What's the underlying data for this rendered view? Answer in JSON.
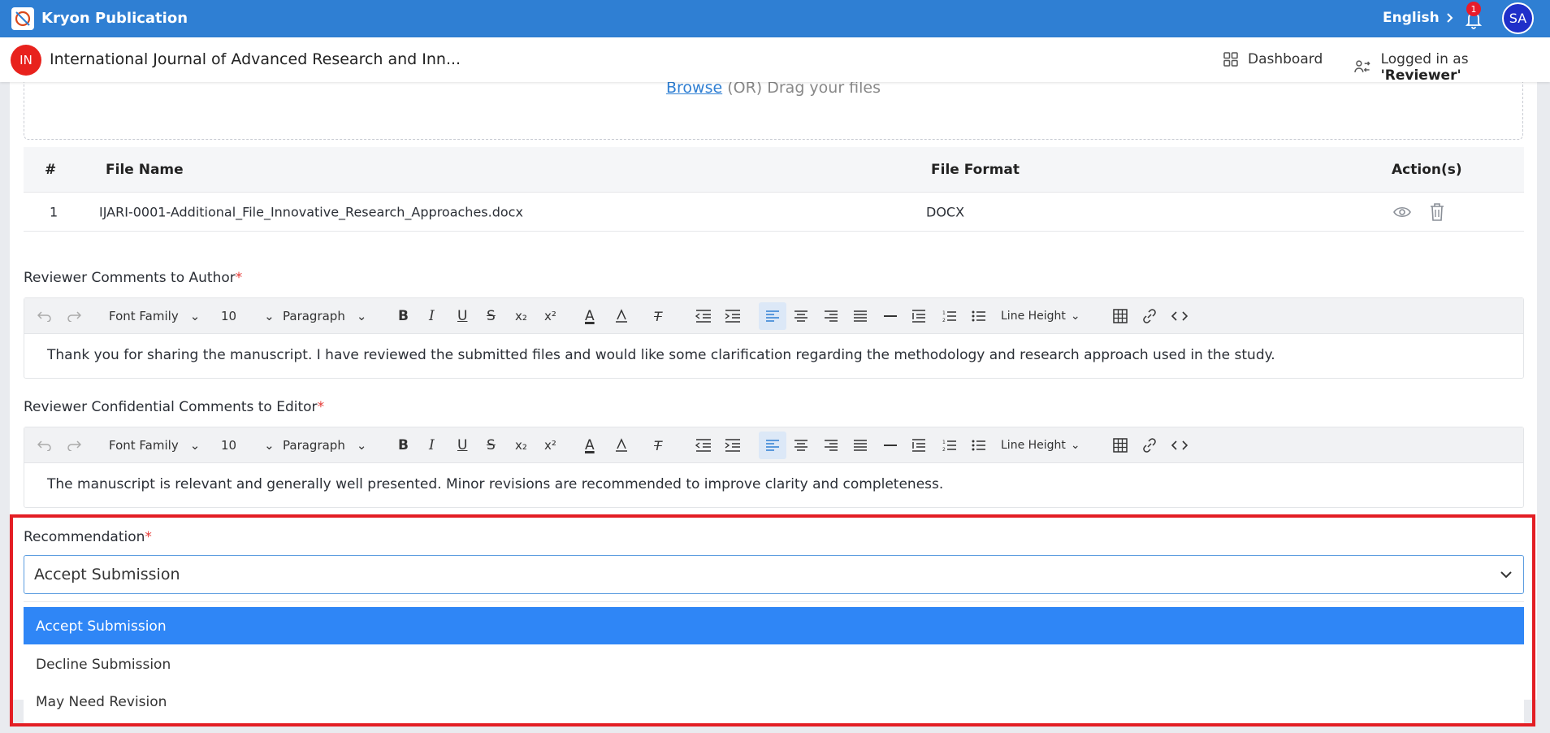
{
  "app": {
    "name": "Kryon Publication",
    "language": "English",
    "notifications": "1",
    "user_initials": "SA"
  },
  "header": {
    "journal_initials": "IN",
    "journal_title": "International Journal of Advanced Research and Inn...",
    "dashboard_label": "Dashboard",
    "logged_prefix": "Logged in as",
    "logged_role": "'Reviewer'"
  },
  "upload": {
    "browse_label": "Browse",
    "rest": " (OR) Drag your files"
  },
  "files": {
    "headers": [
      "#",
      "File Name",
      "File Format",
      "Action(s)"
    ],
    "rows": [
      {
        "num": "1",
        "name": "IJARI-0001-Additional_File_Innovative_Research_Approaches.docx",
        "format": "DOCX"
      }
    ]
  },
  "toolbar": {
    "font_family": "Font Family",
    "font_size": "10",
    "paragraph": "Paragraph",
    "line_height": "Line Height"
  },
  "author_comments": {
    "label": "Reviewer Comments to Author",
    "required": "*",
    "text": "Thank you for sharing the manuscript. I have reviewed the submitted files and would like some clarification regarding the methodology and research approach used in the study."
  },
  "editor_comments": {
    "label": "Reviewer Confidential Comments to Editor",
    "required": "*",
    "text": "The manuscript is relevant and generally well presented. Minor revisions are recommended to improve clarity and completeness."
  },
  "recommendation": {
    "label": "Recommendation",
    "required": "*",
    "selected": "Accept Submission",
    "options": [
      "Accept Submission",
      "Decline Submission",
      "May Need Revision"
    ]
  },
  "colors": {
    "primary": "#2f7fd3",
    "highlight": "#e31e24",
    "selected_option": "#2f86f6",
    "avatar": "#1f2fc9",
    "journal_badge": "#e8221d"
  }
}
